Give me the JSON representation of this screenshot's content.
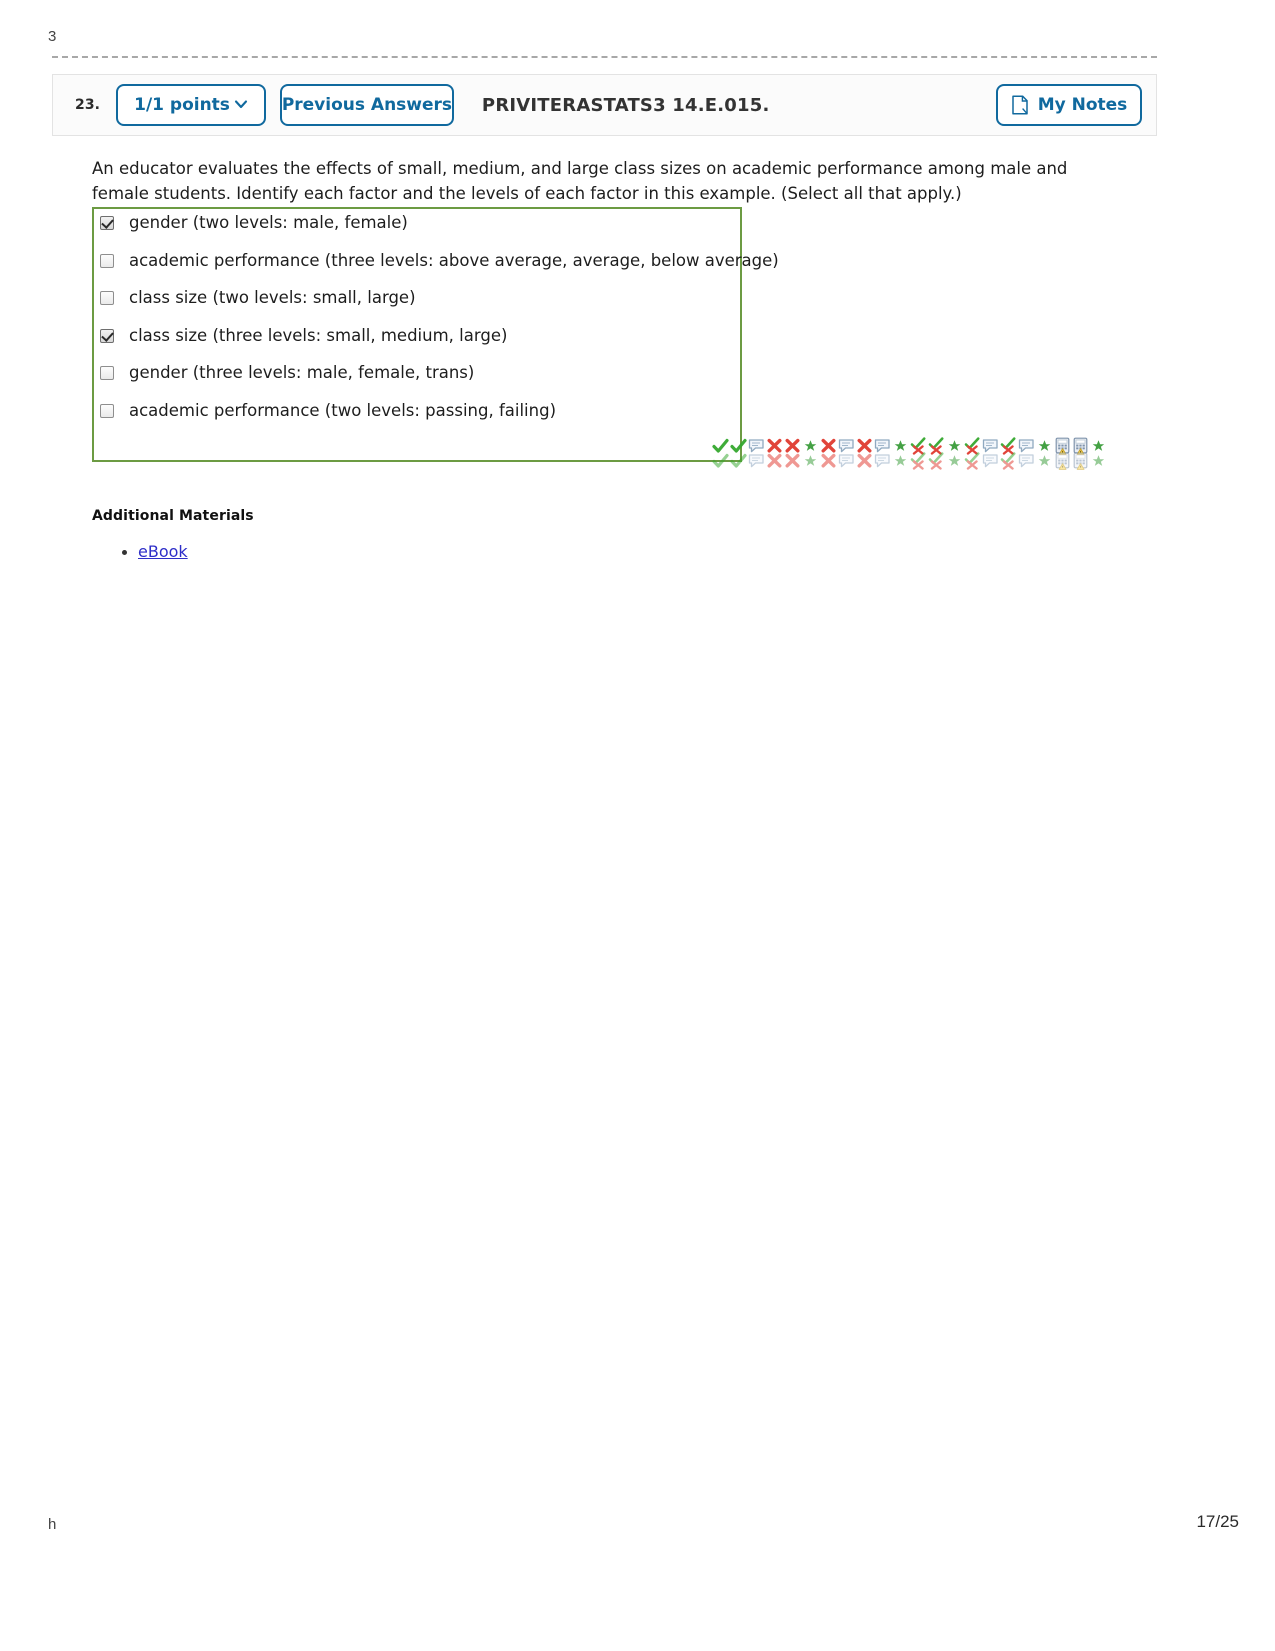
{
  "page": {
    "edge_top_left": "3",
    "edge_bottom_left": "h",
    "footer_page": "17/25"
  },
  "question_header": {
    "number": "23.",
    "points_label": "1/1 points",
    "points_chevron_icon": "chevron-down-icon",
    "previous_answers_label": "Previous Answers",
    "question_id": "PRIVITERASTATS3 14.E.015.",
    "my_notes_label": "My Notes",
    "my_notes_icon": "note-page-icon",
    "accent_color": "#10699e"
  },
  "question": {
    "prompt": "An educator evaluates the effects of small, medium, and large class sizes on academic performance among male and female students. Identify each factor and the levels of each factor in this example. (Select all that apply.)",
    "answer_box_border_color": "#6c9b43",
    "choices": [
      {
        "label": "gender (two levels: male, female)",
        "checked": true
      },
      {
        "label": "academic performance (three levels: above average, average, below average)",
        "checked": false
      },
      {
        "label": "class size (two levels: small, large)",
        "checked": false
      },
      {
        "label": "class size (three levels: small, medium, large)",
        "checked": true
      },
      {
        "label": "gender (three levels: male, female, trans)",
        "checked": false
      },
      {
        "label": "academic performance (two levels: passing, failing)",
        "checked": false
      }
    ]
  },
  "grading_icons": {
    "description": "grading result icon cluster",
    "colors": {
      "correct": "#35a82f",
      "incorrect": "#e03b30",
      "star": "#3a9c3a",
      "calculator": "#7a8fa8"
    },
    "sequence": [
      "check-icon",
      "check-icon",
      "comment-icon",
      "cross-icon",
      "cross-icon",
      "star-icon",
      "cross-icon",
      "comment-icon",
      "cross-icon",
      "comment-icon",
      "star-icon",
      "check-cross-icon",
      "check-cross-icon",
      "star-icon",
      "check-cross-icon",
      "comment-icon",
      "check-cross-icon",
      "comment-icon",
      "star-icon",
      "calculator-icon",
      "calculator-icon",
      "star-icon",
      "calculator-icon",
      "comment-icon",
      "calculator-icon"
    ]
  },
  "additional_materials": {
    "title": "Additional Materials",
    "links": [
      {
        "label": "eBook"
      }
    ]
  }
}
